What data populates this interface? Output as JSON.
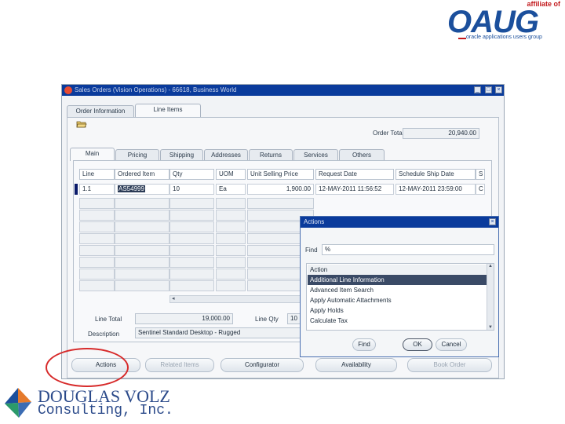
{
  "oaug": {
    "affiliate": "affiliate of",
    "letters": "OAUG",
    "tagline": "oracle applications users group"
  },
  "window": {
    "title": "Sales Orders (Vision Operations) - 66618, Business World",
    "tabs": [
      "Order Information",
      "Line Items"
    ],
    "order_total_label": "Order Total",
    "order_total_value": "20,940.00",
    "sub_tabs": [
      "Main",
      "Pricing",
      "Shipping",
      "Addresses",
      "Returns",
      "Services",
      "Others"
    ],
    "grid": {
      "headers": [
        "Line",
        "Ordered Item",
        "Qty",
        "UOM",
        "Unit Selling Price",
        "Request Date",
        "Schedule Ship Date",
        "S"
      ],
      "row": [
        "1.1",
        "AS54999",
        "10",
        "Ea",
        "1,900.00",
        "12-MAY-2011 11:56:52",
        "12-MAY-2011 23:59:00",
        "C"
      ]
    },
    "line_total_label": "Line Total",
    "line_total_value": "19,000.00",
    "line_qty_label": "Line Qty",
    "line_qty_value": "10",
    "description_label": "Description",
    "description_value": "Sentinel Standard Desktop - Rugged",
    "buttons": [
      "Actions",
      "Related Items",
      "Configurator",
      "Availability",
      "Book Order"
    ]
  },
  "dialog": {
    "title": "Actions",
    "find_label": "Find",
    "find_value": "%",
    "items": [
      "Action",
      "Additional Line Information",
      "Advanced Item Search",
      "Apply Automatic Attachments",
      "Apply Holds",
      "Calculate Tax"
    ],
    "buttons": [
      "Find",
      "OK",
      "Cancel"
    ]
  },
  "dv_logo": {
    "line1": "DOUGLAS VOLZ",
    "line2": "Consulting, Inc."
  },
  "colors": {
    "title_bar": "#0a3b9c",
    "highlight_circle": "#d72a2a",
    "brand_blue": "#1b4f9c"
  }
}
